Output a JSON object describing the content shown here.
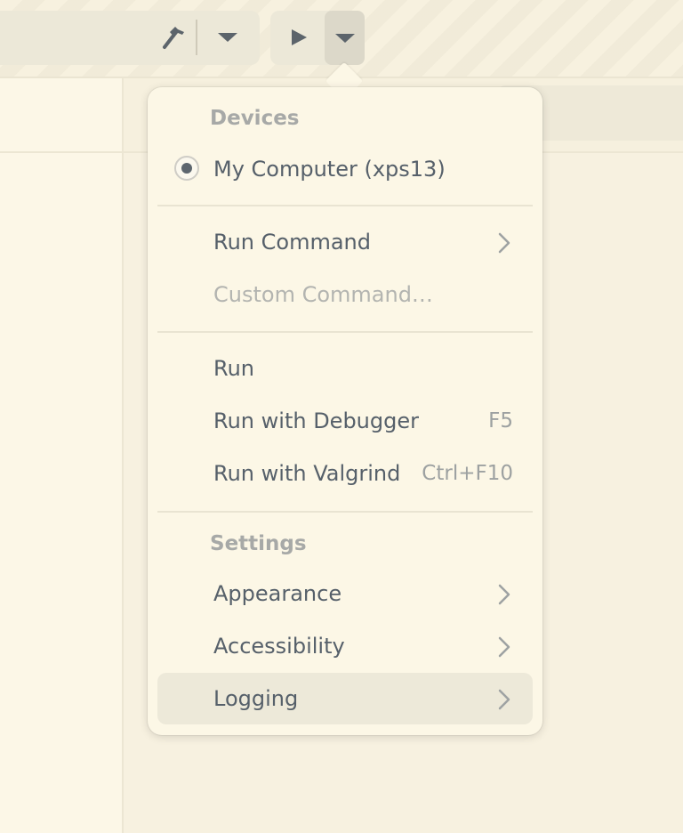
{
  "header": {
    "build_icon": "hammer-icon",
    "build_menu_icon": "pan-down-icon",
    "run_icon": "play-icon",
    "run_menu_icon": "pan-down-icon"
  },
  "menu": {
    "devices_title": "Devices",
    "device_item": {
      "label": "My Computer (xps13)",
      "selected": true
    },
    "run_command": {
      "label": "Run Command",
      "icon": "chevron-right-icon"
    },
    "custom_command": {
      "label": "Custom Command…",
      "disabled": true
    },
    "run": {
      "label": "Run"
    },
    "run_debugger": {
      "label": "Run with Debugger",
      "accel": "F5"
    },
    "run_valgrind": {
      "label": "Run with Valgrind",
      "accel": "Ctrl+F10"
    },
    "settings_title": "Settings",
    "appearance": {
      "label": "Appearance",
      "icon": "chevron-right-icon"
    },
    "accessibility": {
      "label": "Accessibility",
      "icon": "chevron-right-icon"
    },
    "logging": {
      "label": "Logging",
      "icon": "chevron-right-icon",
      "highlighted": true
    }
  },
  "colors": {
    "background": "#fbf6e6",
    "popover": "#fcf7e6",
    "text": "#56606a",
    "muted": "#a7a9a7",
    "highlight": "#ede9d9"
  }
}
